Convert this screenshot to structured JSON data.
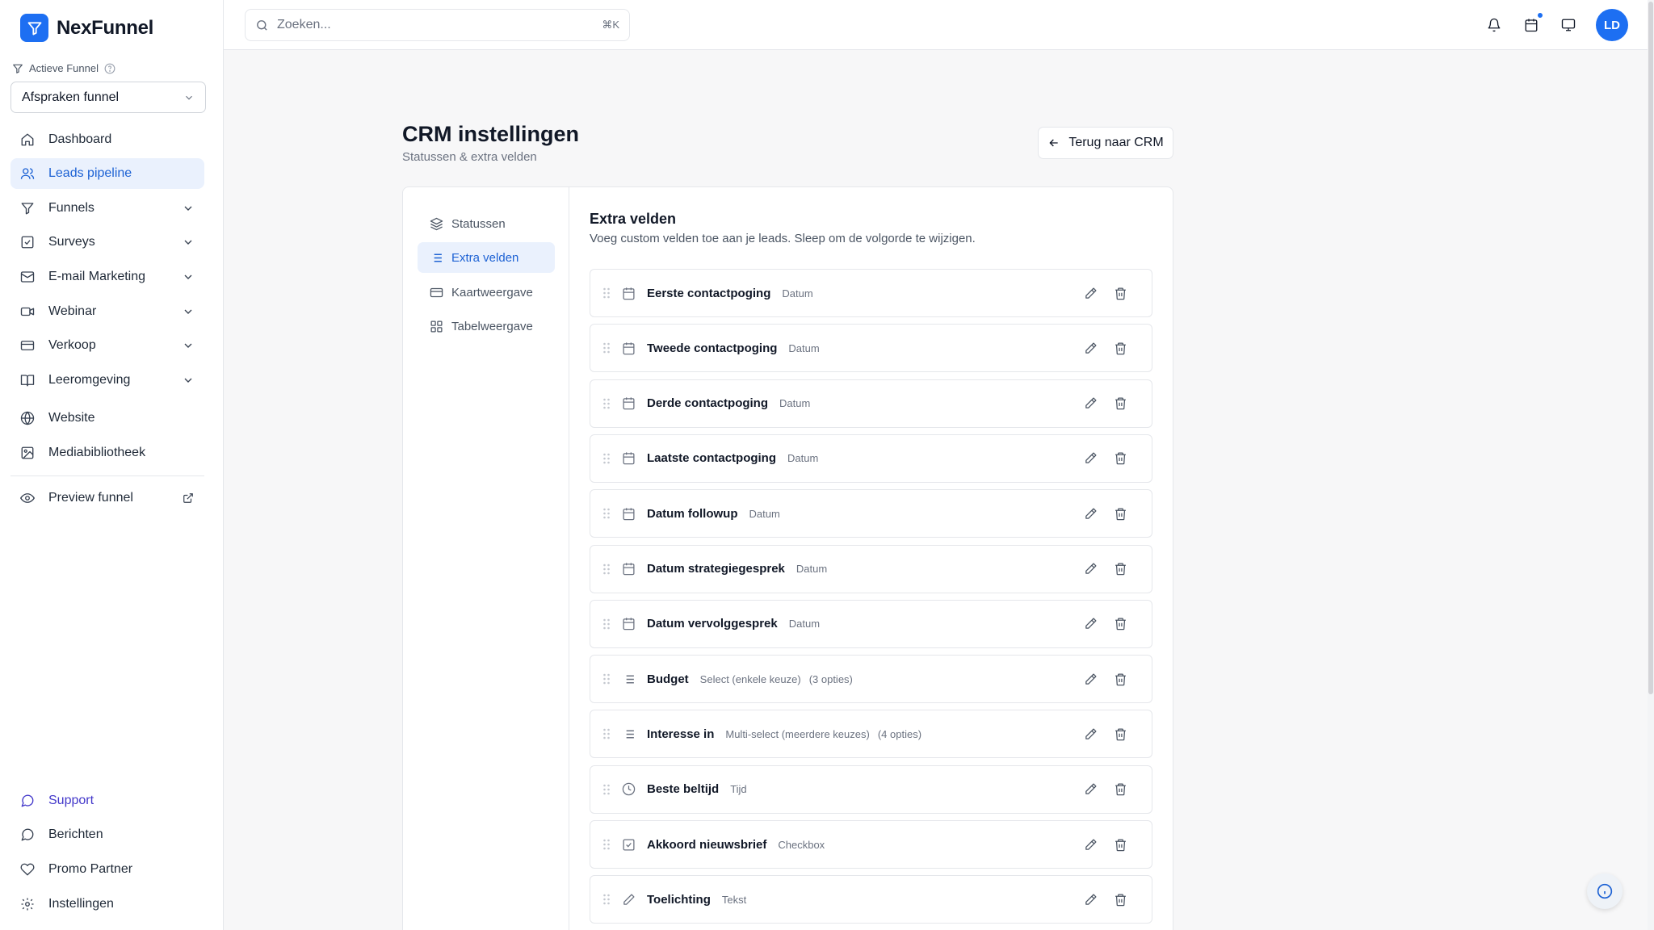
{
  "brand": {
    "name": "NexFunnel"
  },
  "sidebar": {
    "funnel_label": "Actieve Funnel",
    "funnel_value": "Afspraken funnel",
    "items": [
      {
        "label": "Dashboard",
        "icon": "home-icon"
      },
      {
        "label": "Leads pipeline",
        "icon": "users-icon",
        "active": true
      },
      {
        "label": "Funnels",
        "icon": "funnel-icon",
        "expandable": true
      },
      {
        "label": "Surveys",
        "icon": "check-square-icon",
        "expandable": true
      },
      {
        "label": "E-mail Marketing",
        "icon": "mail-icon",
        "expandable": true
      },
      {
        "label": "Webinar",
        "icon": "video-icon",
        "expandable": true
      },
      {
        "label": "Verkoop",
        "icon": "credit-card-icon",
        "expandable": true
      },
      {
        "label": "Leeromgeving",
        "icon": "book-icon",
        "expandable": true
      },
      {
        "label": "Website",
        "icon": "globe-icon"
      },
      {
        "label": "Mediabibliotheek",
        "icon": "image-icon"
      },
      {
        "label": "Preview funnel",
        "icon": "eye-icon"
      }
    ],
    "bottom_items": [
      {
        "label": "Support",
        "icon": "message-circle-icon"
      },
      {
        "label": "Berichten",
        "icon": "message-icon"
      },
      {
        "label": "Promo Partner",
        "icon": "heart-icon"
      },
      {
        "label": "Instellingen",
        "icon": "gear-icon"
      }
    ]
  },
  "topbar": {
    "search_placeholder": "Zoeken...",
    "shortcut": "⌘K",
    "avatar_initials": "LD"
  },
  "page": {
    "title": "CRM instellingen",
    "subtitle": "Statussen & extra velden",
    "back_label": "Terug naar CRM"
  },
  "settings_nav": [
    {
      "label": "Statussen",
      "icon": "layers-icon"
    },
    {
      "label": "Extra velden",
      "icon": "list-icon",
      "active": true
    },
    {
      "label": "Kaartweergave",
      "icon": "card-icon"
    },
    {
      "label": "Tabelweergave",
      "icon": "grid-icon"
    }
  ],
  "extra_fields": {
    "title": "Extra velden",
    "description": "Voeg custom velden toe aan je leads. Sleep om de volgorde te wijzigen.",
    "fields": [
      {
        "name": "Eerste contactpoging",
        "type": "Datum",
        "icon": "calendar-icon"
      },
      {
        "name": "Tweede contactpoging",
        "type": "Datum",
        "icon": "calendar-icon"
      },
      {
        "name": "Derde contactpoging",
        "type": "Datum",
        "icon": "calendar-icon"
      },
      {
        "name": "Laatste contactpoging",
        "type": "Datum",
        "icon": "calendar-icon"
      },
      {
        "name": "Datum followup",
        "type": "Datum",
        "icon": "calendar-icon"
      },
      {
        "name": "Datum strategiegesprek",
        "type": "Datum",
        "icon": "calendar-icon"
      },
      {
        "name": "Datum vervolggesprek",
        "type": "Datum",
        "icon": "calendar-icon"
      },
      {
        "name": "Budget",
        "type": "Select (enkele keuze)",
        "count": "(3 opties)",
        "icon": "list-icon"
      },
      {
        "name": "Interesse in",
        "type": "Multi-select (meerdere keuzes)",
        "count": "(4 opties)",
        "icon": "list-icon"
      },
      {
        "name": "Beste beltijd",
        "type": "Tijd",
        "icon": "clock-icon"
      },
      {
        "name": "Akkoord nieuwsbrief",
        "type": "Checkbox",
        "icon": "checkbox-icon"
      },
      {
        "name": "Toelichting",
        "type": "Tekst",
        "icon": "pencil-icon"
      }
    ]
  },
  "colors": {
    "accent": "#1d6ff2",
    "active_bg": "#eaf1fd",
    "active_text": "#1d62d4"
  }
}
